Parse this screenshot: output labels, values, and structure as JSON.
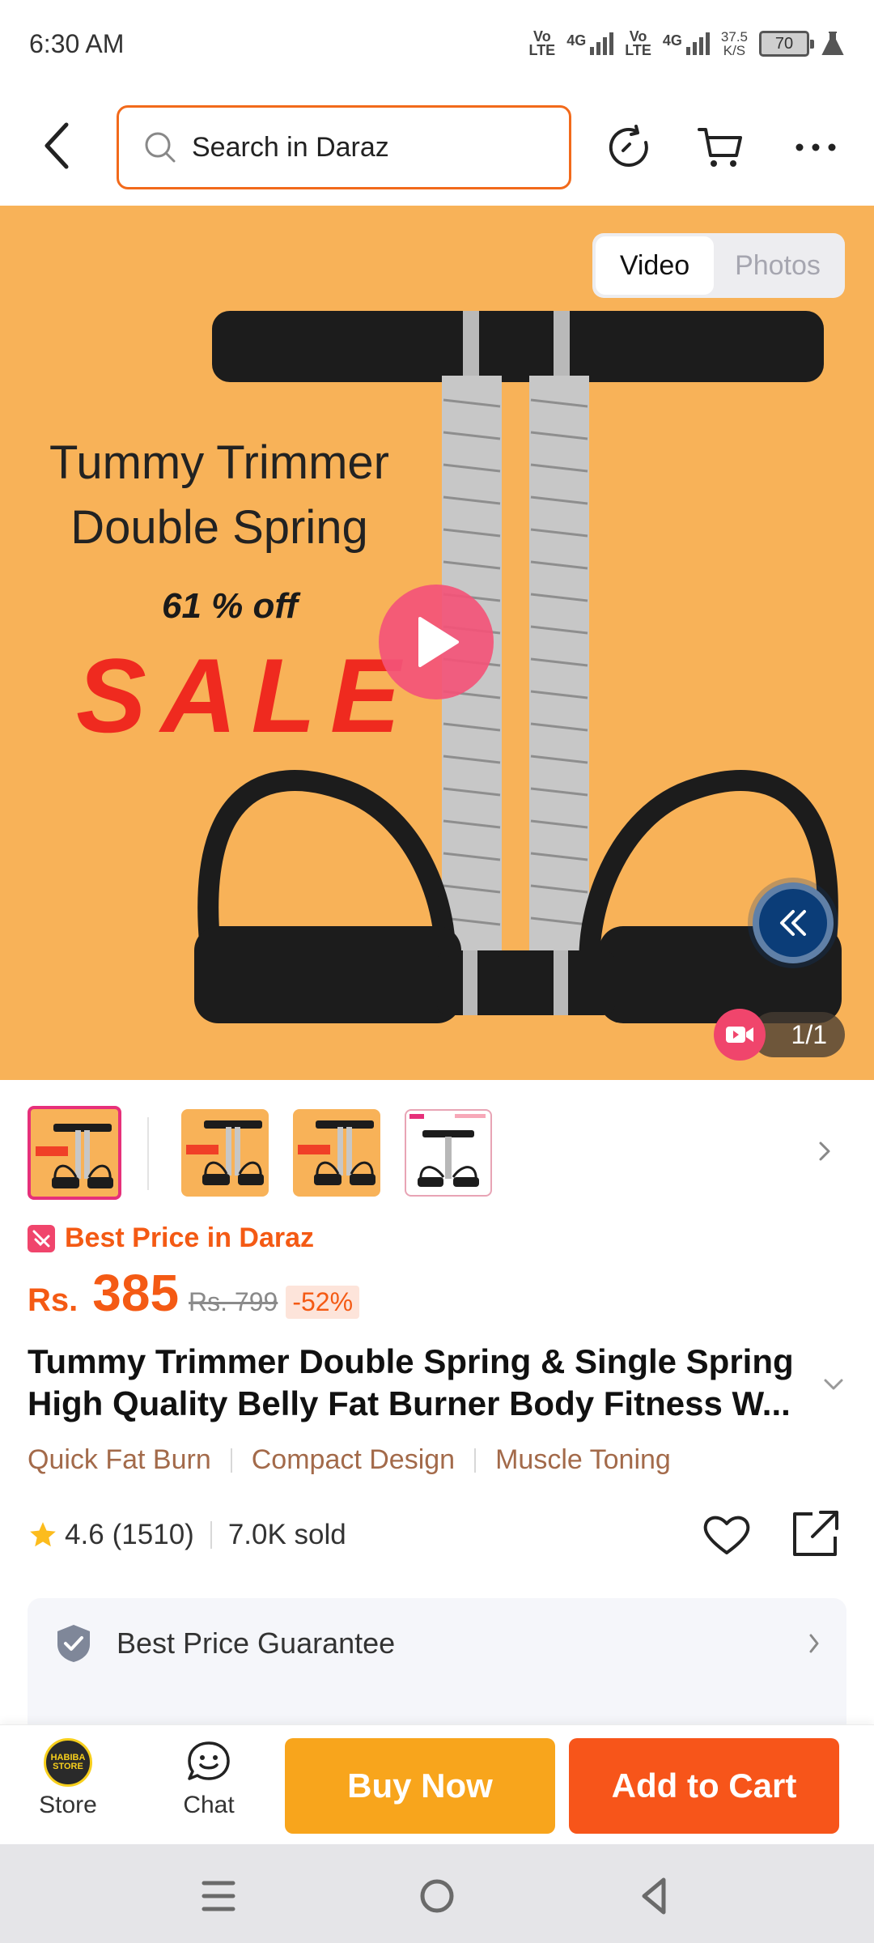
{
  "status_bar": {
    "time": "6:30 AM",
    "sim1_top": "Vo",
    "sim1_bottom": "LTE",
    "sim1_net": "4G",
    "sim2_top": "Vo",
    "sim2_bottom": "LTE",
    "sim2_net": "4G",
    "speed_value": "37.5",
    "speed_unit": "K/S",
    "battery": "70"
  },
  "header": {
    "search_placeholder": "Search in Daraz",
    "icons": [
      "back-icon",
      "search-icon",
      "history-icon",
      "cart-icon",
      "more-icon"
    ]
  },
  "hero": {
    "toggle": {
      "video": "Video",
      "photos": "Photos",
      "active": "Video"
    },
    "promo_line1": "Tummy Trimmer",
    "promo_line2": "Double Spring",
    "promo_off": "61 % off",
    "promo_sale": "SALE",
    "counter": "1/1",
    "colors": {
      "background": "#f8b258",
      "play": "#f35478",
      "collapse": "#0b3d78"
    }
  },
  "thumbnails": {
    "count": 4,
    "selected_index": 0
  },
  "price": {
    "best_price_label": "Best Price in Daraz",
    "currency": "Rs.",
    "current": "385",
    "original": "Rs. 799",
    "discount": "-52%",
    "accent": "#f45a14"
  },
  "product": {
    "title": "Tummy Trimmer Double Spring & Single Spring High Quality Belly Fat Burner Body Fitness W...",
    "tags": [
      "Quick Fat Burn",
      "Compact Design",
      "Muscle Toning"
    ],
    "rating": "4.6",
    "reviews": "(1510)",
    "sold": "7.0K sold"
  },
  "guarantee": {
    "label": "Best Price Guarantee"
  },
  "bottom_bar": {
    "store_label": "Store",
    "store_logo_text": "HABIBA STORE",
    "chat_label": "Chat",
    "buy_now": "Buy Now",
    "add_to_cart": "Add to Cart",
    "buy_color": "#f8a51c",
    "cart_color": "#f7551a"
  }
}
